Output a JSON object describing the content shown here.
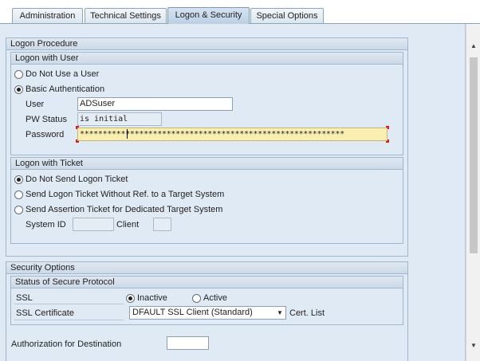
{
  "tabs": [
    {
      "label": "Administration",
      "active": false
    },
    {
      "label": "Technical Settings",
      "active": false
    },
    {
      "label": "Logon & Security",
      "active": true
    },
    {
      "label": "Special Options",
      "active": false
    }
  ],
  "logon_procedure": {
    "title": "Logon Procedure",
    "logon_with_user": {
      "title": "Logon with User",
      "options": [
        {
          "label": "Do Not Use a User",
          "selected": false
        },
        {
          "label": "Basic Authentication",
          "selected": true
        }
      ],
      "user_label": "User",
      "user_value": "ADSuser",
      "pw_status_label": "PW Status",
      "pw_status_value": "is initial",
      "password_label": "Password",
      "password_value": "**********************************************************"
    },
    "logon_with_ticket": {
      "title": "Logon with Ticket",
      "options": [
        {
          "label": "Do Not Send Logon Ticket",
          "selected": true
        },
        {
          "label": "Send Logon Ticket Without Ref. to a Target System",
          "selected": false
        },
        {
          "label": "Send Assertion Ticket for Dedicated Target System",
          "selected": false
        }
      ],
      "system_id_label": "System ID",
      "system_id_value": "",
      "client_label": "Client",
      "client_value": ""
    }
  },
  "security_options": {
    "title": "Security Options",
    "secure_protocol": {
      "title": "Status of Secure Protocol",
      "ssl_label": "SSL",
      "ssl_options": [
        {
          "label": "Inactive",
          "selected": true
        },
        {
          "label": "Active",
          "selected": false
        }
      ],
      "ssl_cert_label": "SSL Certificate",
      "ssl_cert_value": "DFAULT SSL Client (Standard)",
      "cert_list_label": "Cert. List"
    },
    "auth_destination_label": "Authorization for Destination",
    "auth_destination_value": ""
  },
  "colors": {
    "panel_bg": "#dfeaf5",
    "password_bg": "#faeeb0",
    "required_marker": "#d62020"
  }
}
